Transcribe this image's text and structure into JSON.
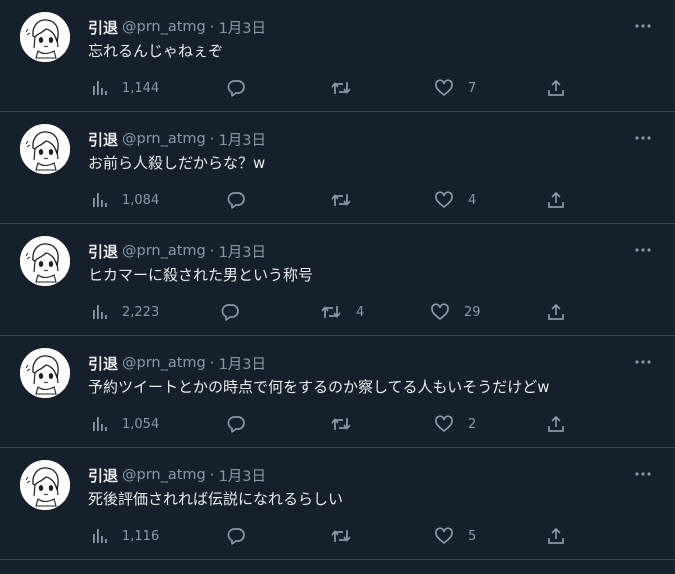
{
  "tweets": [
    {
      "display_name": "引退",
      "handle": "@prn_atmg",
      "separator": "·",
      "date": "1月3日",
      "text": "忘れるんじゃねぇぞ",
      "views": "1,144",
      "replies": "",
      "retweets": "",
      "likes": "7"
    },
    {
      "display_name": "引退",
      "handle": "@prn_atmg",
      "separator": "·",
      "date": "1月3日",
      "text": "お前ら人殺しだからな？w",
      "views": "1,084",
      "replies": "",
      "retweets": "",
      "likes": "4"
    },
    {
      "display_name": "引退",
      "handle": "@prn_atmg",
      "separator": "·",
      "date": "1月3日",
      "text": "ヒカマーに殺された男という称号",
      "views": "2,223",
      "replies": "",
      "retweets": "4",
      "likes": "29"
    },
    {
      "display_name": "引退",
      "handle": "@prn_atmg",
      "separator": "·",
      "date": "1月3日",
      "text": "予約ツイートとかの時点で何をするのか察してる人もいそうだけどw",
      "views": "1,054",
      "replies": "",
      "retweets": "",
      "likes": "2"
    },
    {
      "display_name": "引退",
      "handle": "@prn_atmg",
      "separator": "·",
      "date": "1月3日",
      "text": "死後評価されれば伝説になれるらしい",
      "views": "1,116",
      "replies": "",
      "retweets": "",
      "likes": "5"
    }
  ],
  "icons": {
    "views": "bar-chart-icon",
    "reply": "speech-bubble-icon",
    "retweet": "retweet-arrows-icon",
    "like": "heart-icon",
    "share": "share-upload-icon",
    "more": "more-dots-icon"
  },
  "colors": {
    "background": "#15202b",
    "divider": "#38444d",
    "primary_text": "#e7e9ea",
    "secondary_text": "#8b98a5"
  }
}
